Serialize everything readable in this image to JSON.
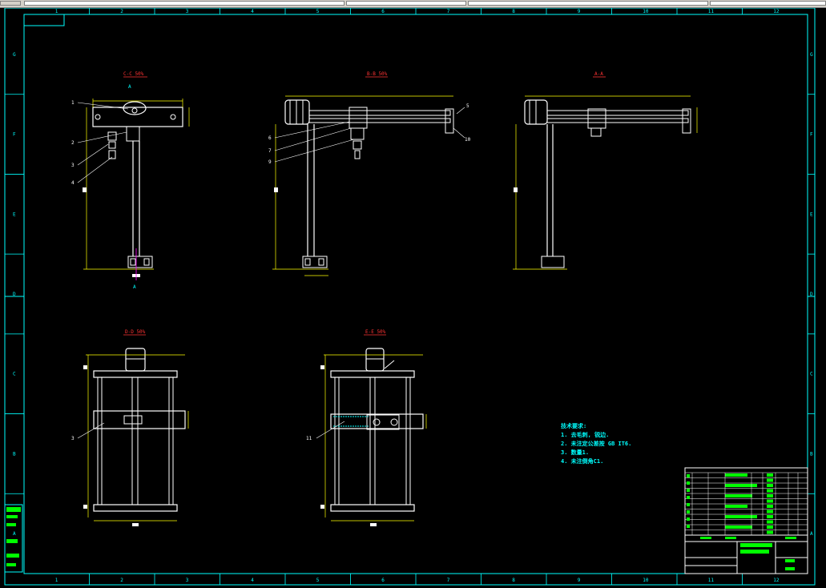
{
  "ruler": {
    "top": [
      "1",
      "2",
      "3",
      "4",
      "5",
      "6",
      "7",
      "8",
      "9",
      "10",
      "11",
      "12"
    ],
    "bottom": [
      "1",
      "2",
      "3",
      "4",
      "5",
      "6",
      "7",
      "8",
      "9",
      "10",
      "11",
      "12"
    ],
    "left": [
      "G",
      "F",
      "E",
      "D",
      "C",
      "B",
      "A"
    ],
    "right": [
      "G",
      "F",
      "E",
      "D",
      "C",
      "B",
      "A"
    ]
  },
  "views": {
    "front_title": "C-C 50%",
    "side_title": "B-B 50%",
    "section_title": "A-A",
    "bottom_left_title": "D-D 50%",
    "bottom_right_title": "E-E 50%"
  },
  "markers": {
    "section_a_top": "A",
    "section_a_bottom": "A"
  },
  "part_labels": {
    "front": [
      "1",
      "2",
      "3",
      "4"
    ],
    "side": [
      "5",
      "6",
      "7",
      "9",
      "10"
    ],
    "bottom_left": "3",
    "bottom_right": "11"
  },
  "notes": {
    "title": "技术要求:",
    "items": [
      "1. 去毛刺, 锐边.",
      "2. 未注定公差按 GB IT6.",
      "3. 数量1.",
      "4. 未注倒角C1."
    ]
  },
  "colors": {
    "background": "#000000",
    "frame": "#00ffff",
    "drawing": "#ffffff",
    "dimension": "#ffff00",
    "title_text": "#ff3333",
    "titleblock_fill": "#00ff00",
    "marker": "#ff00ff"
  }
}
